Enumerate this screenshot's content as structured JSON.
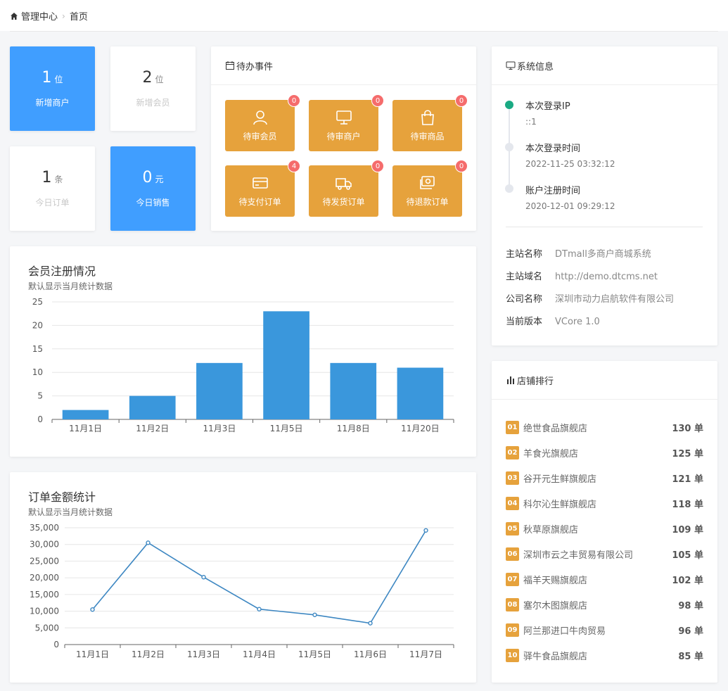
{
  "breadcrumb": {
    "root": "管理中心",
    "current": "首页"
  },
  "stats": [
    {
      "num": "1",
      "unit": "位",
      "label": "新增商户"
    },
    {
      "num": "2",
      "unit": "位",
      "label": "新增会员"
    },
    {
      "num": "1",
      "unit": "条",
      "label": "今日订单"
    },
    {
      "num": "0",
      "unit": "元",
      "label": "今日销售"
    }
  ],
  "todo": {
    "title": "待办事件",
    "items": [
      {
        "label": "待审会员",
        "count": "0",
        "icon": "user-icon"
      },
      {
        "label": "待审商户",
        "count": "0",
        "icon": "monitor-icon"
      },
      {
        "label": "待审商品",
        "count": "0",
        "icon": "shopping-bag-icon"
      },
      {
        "label": "待支付订单",
        "count": "4",
        "icon": "credit-card-icon"
      },
      {
        "label": "待发货订单",
        "count": "0",
        "icon": "truck-icon"
      },
      {
        "label": "待退款订单",
        "count": "0",
        "icon": "refund-icon"
      }
    ]
  },
  "sysinfo": {
    "title": "系统信息",
    "timeline": [
      {
        "title": "本次登录IP",
        "value": "::1"
      },
      {
        "title": "本次登录时间",
        "value": "2022-11-25 03:32:12"
      },
      {
        "title": "账户注册时间",
        "value": "2020-12-01 09:29:12"
      }
    ],
    "rows": [
      {
        "key": "主站名称",
        "value": "DTmall多商户商城系统"
      },
      {
        "key": "主站域名",
        "value": "http://demo.dtcms.net"
      },
      {
        "key": "公司名称",
        "value": "深圳市动力启航软件有限公司"
      },
      {
        "key": "当前版本",
        "value": "VCore 1.0"
      }
    ]
  },
  "ranking": {
    "title": "店铺排行",
    "items": [
      {
        "no": "01",
        "name": "绝世食品旗舰店",
        "value": "130 单"
      },
      {
        "no": "02",
        "name": "羊食光旗舰店",
        "value": "125 单"
      },
      {
        "no": "03",
        "name": "谷开元生鲜旗舰店",
        "value": "121 单"
      },
      {
        "no": "04",
        "name": "科尔沁生鲜旗舰店",
        "value": "118 单"
      },
      {
        "no": "05",
        "name": "秋草原旗舰店",
        "value": "109 单"
      },
      {
        "no": "06",
        "name": "深圳市云之丰贸易有限公司",
        "value": "105 单"
      },
      {
        "no": "07",
        "name": "福羊天赐旗舰店",
        "value": "102 单"
      },
      {
        "no": "08",
        "name": "塞尔木图旗舰店",
        "value": "98 单"
      },
      {
        "no": "09",
        "name": "阿兰那进口牛肉贸易",
        "value": "96 单"
      },
      {
        "no": "10",
        "name": "驿牛食品旗舰店",
        "value": "85 单"
      }
    ]
  },
  "colors": {
    "primary": "#409eff",
    "warning": "#e6a23c",
    "danger": "#f56c6c",
    "success": "#1aaa83",
    "bar": "#3a97dc",
    "line": "#3d87c2"
  },
  "chart_data": [
    {
      "type": "bar",
      "title": "会员注册情况",
      "subtitle": "默认显示当月统计数据",
      "categories": [
        "11月1日",
        "11月2日",
        "11月3日",
        "11月5日",
        "11月8日",
        "11月20日"
      ],
      "values": [
        2,
        5,
        12,
        23,
        12,
        11
      ],
      "ylim": [
        0,
        25
      ],
      "yticks": [
        "0",
        "5",
        "10",
        "15",
        "20",
        "25"
      ],
      "grid": true
    },
    {
      "type": "line",
      "title": "订单金额统计",
      "subtitle": "默认显示当月统计数据",
      "categories": [
        "11月1日",
        "11月2日",
        "11月3日",
        "11月4日",
        "11月5日",
        "11月6日",
        "11月7日"
      ],
      "values": [
        10500,
        30500,
        20200,
        10600,
        8900,
        6400,
        34200
      ],
      "ylim": [
        0,
        35000
      ],
      "yticks": [
        "0",
        "5,000",
        "10,000",
        "15,000",
        "20,000",
        "25,000",
        "30,000",
        "35,000"
      ],
      "grid": true
    }
  ]
}
